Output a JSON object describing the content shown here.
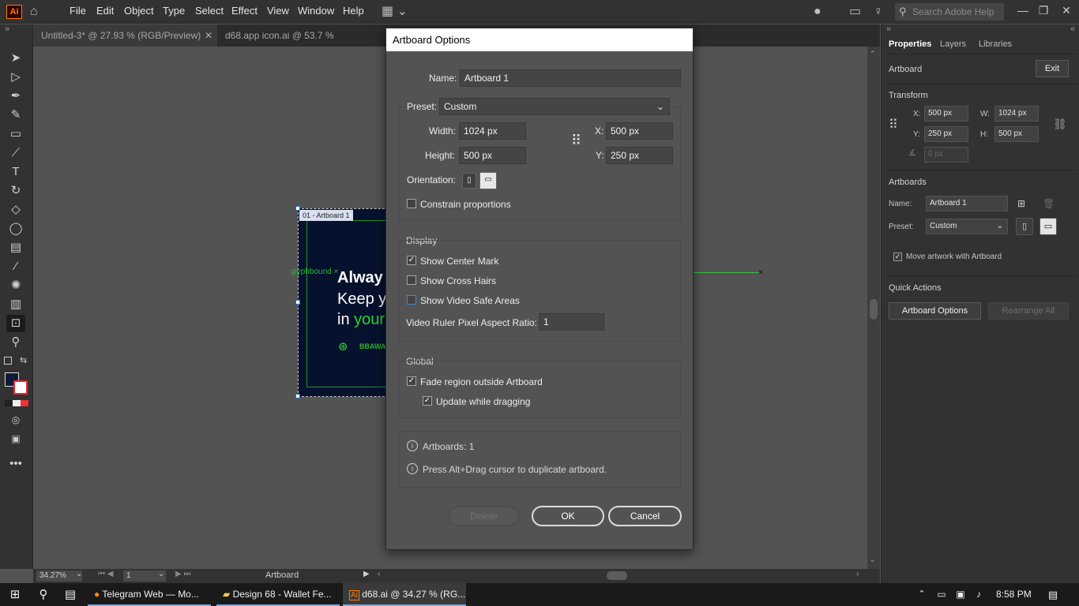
{
  "app": {
    "logo": "Ai",
    "menu": [
      "File",
      "Edit",
      "Object",
      "Type",
      "Select",
      "Effect",
      "View",
      "Window",
      "Help"
    ],
    "search_placeholder": "Search Adobe Help"
  },
  "tabs": [
    {
      "label": "Untitled-3* @ 27.93 % (RGB/Preview)"
    },
    {
      "label": "d68.app icon.ai @ 53.7 % (RGB/Preview)"
    }
  ],
  "canvas": {
    "artboard_label": "01 - Artboard 1",
    "glyph_label": "glyphbound",
    "art_line1": "Alway",
    "art_line2": "Keep y",
    "art_line3a": "in ",
    "art_line3b": "your",
    "art_logo_text": "BBAWALL"
  },
  "statusbar": {
    "zoom": "34.27%",
    "page": "1",
    "tool_label": "Artboard"
  },
  "right_panel": {
    "tabs": [
      "Properties",
      "Layers",
      "Libraries"
    ],
    "section_artboard": "Artboard",
    "exit_label": "Exit",
    "transform_title": "Transform",
    "x_label": "X:",
    "x_value": "500 px",
    "y_label": "Y:",
    "y_value": "250 px",
    "w_label": "W:",
    "w_value": "1024 px",
    "h_label": "H:",
    "h_value": "500 px",
    "rotate_value": "0 px",
    "artboards_title": "Artboards",
    "name_label": "Name:",
    "name_value": "Artboard 1",
    "preset_label": "Preset:",
    "preset_value": "Custom",
    "move_artwork_label": "Move artwork with Artboard",
    "quick_actions_title": "Quick Actions",
    "artboard_options_label": "Artboard Options",
    "rearrange_label": "Rearrange All"
  },
  "dialog": {
    "title": "Artboard Options",
    "name_label": "Name:",
    "name_value": "Artboard 1",
    "preset_label": "Preset:",
    "preset_value": "Custom",
    "width_label": "Width:",
    "width_value": "1024 px",
    "height_label": "Height:",
    "height_value": "500 px",
    "x_label": "X:",
    "x_value": "500 px",
    "y_label": "Y:",
    "y_value": "250 px",
    "orientation_label": "Orientation:",
    "constrain_label": "Constrain proportions",
    "display_title": "Display",
    "show_center_mark": "Show Center Mark",
    "show_cross_hairs": "Show Cross Hairs",
    "show_video_safe": "Show Video Safe Areas",
    "video_ratio_label": "Video Ruler Pixel Aspect Ratio:",
    "video_ratio_value": "1",
    "global_title": "Global",
    "fade_region": "Fade region outside Artboard",
    "update_dragging": "Update while dragging",
    "artboards_count": "Artboards: 1",
    "hint": "Press Alt+Drag cursor to duplicate artboard.",
    "delete_label": "Delete",
    "ok_label": "OK",
    "cancel_label": "Cancel"
  },
  "taskbar": {
    "items": [
      {
        "label": "Telegram Web — Mo..."
      },
      {
        "label": "Design 68 - Wallet Fe..."
      },
      {
        "label": "d68.ai @ 34.27 % (RG..."
      }
    ],
    "time": "8:58 PM"
  }
}
